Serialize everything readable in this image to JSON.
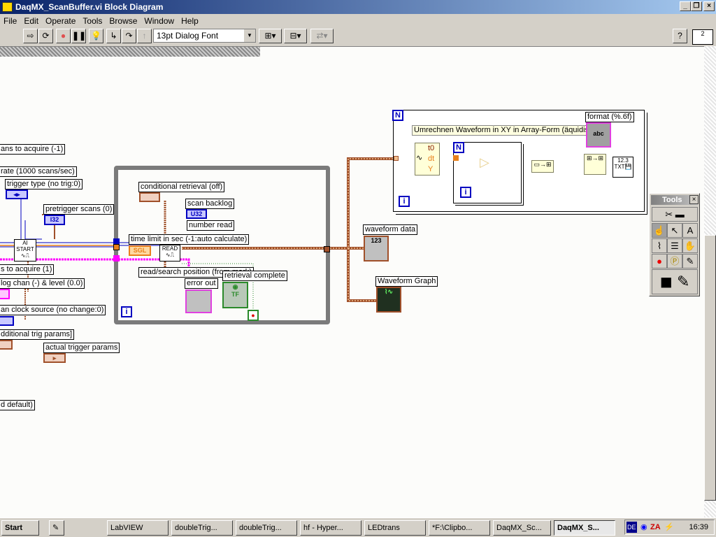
{
  "window": {
    "title": "DaqMX_ScanBuffer.vi Block Diagram"
  },
  "menu": [
    "File",
    "Edit",
    "Operate",
    "Tools",
    "Browse",
    "Window",
    "Help"
  ],
  "toolbar": {
    "font": "13pt Dialog Font",
    "connector_number": "2"
  },
  "labels": {
    "scans_to_acquire": "ans to acquire (-1)",
    "scan_rate": "rate (1000 scans/sec)",
    "trigger_type": "trigger type (no trig:0)",
    "pretrigger_scans": "pretrigger scans (0)",
    "ai_start": "AI START",
    "to_acquire": "s to acquire (1)",
    "analog_chan": "log chan (-) & level (0.0)",
    "clock_source": "an clock source (no change:0)",
    "additional_trig": "dditional trig params]",
    "actual_trigger": "actual trigger params",
    "default": "d default)",
    "conditional_retrieval": "conditional retrieval (off)",
    "scan_backlog": "scan backlog",
    "number_read": "number read",
    "time_limit": "time limit in sec (-1:auto calculate)",
    "read": "READ",
    "read_search": "read/search position (from mark)",
    "error_out": "error out",
    "retrieval_complete": "retrieval complete",
    "waveform_data": "waveform data",
    "waveform_graph": "Waveform Graph",
    "comment": "Umrechnen Waveform in XY in Array-Form (äquidist",
    "format": "format (%.6f)",
    "t0": "t0",
    "dt": "dt",
    "y": "Y",
    "N": "N",
    "i": "i",
    "sgl": "SGL",
    "u32": "U32",
    "i32": "I32",
    "abc": "abc",
    "n123": "123",
    "txt": "TXT",
    "n12_3": "12.3"
  },
  "tools_palette": {
    "title": "Tools",
    "tools": [
      "automatic-tool",
      "operate-value",
      "position-select",
      "edit-text",
      "connect-wire",
      "object-shortcut-menu",
      "scroll-window",
      "set-breakpoint",
      "probe-data",
      "get-color",
      "set-color"
    ]
  },
  "taskbar": {
    "start": "Start",
    "items": [
      "LabVIEW",
      "doubleTrig...",
      "doubleTrig...",
      "hf - Hyper...",
      "LEDtrans",
      "*F:\\Clipbo...",
      "DaqMX_Sc...",
      "DaqMX_S..."
    ],
    "active": "DaqMX_S...",
    "lang": "DE",
    "clock": "16:39"
  },
  "colors": {
    "wire_orange": "#e8801c",
    "wire_cluster": "#a0502a",
    "wire_blue": "#0000c0",
    "wire_pink": "#ff00ff",
    "loop_gray": "#7b7b7b"
  }
}
